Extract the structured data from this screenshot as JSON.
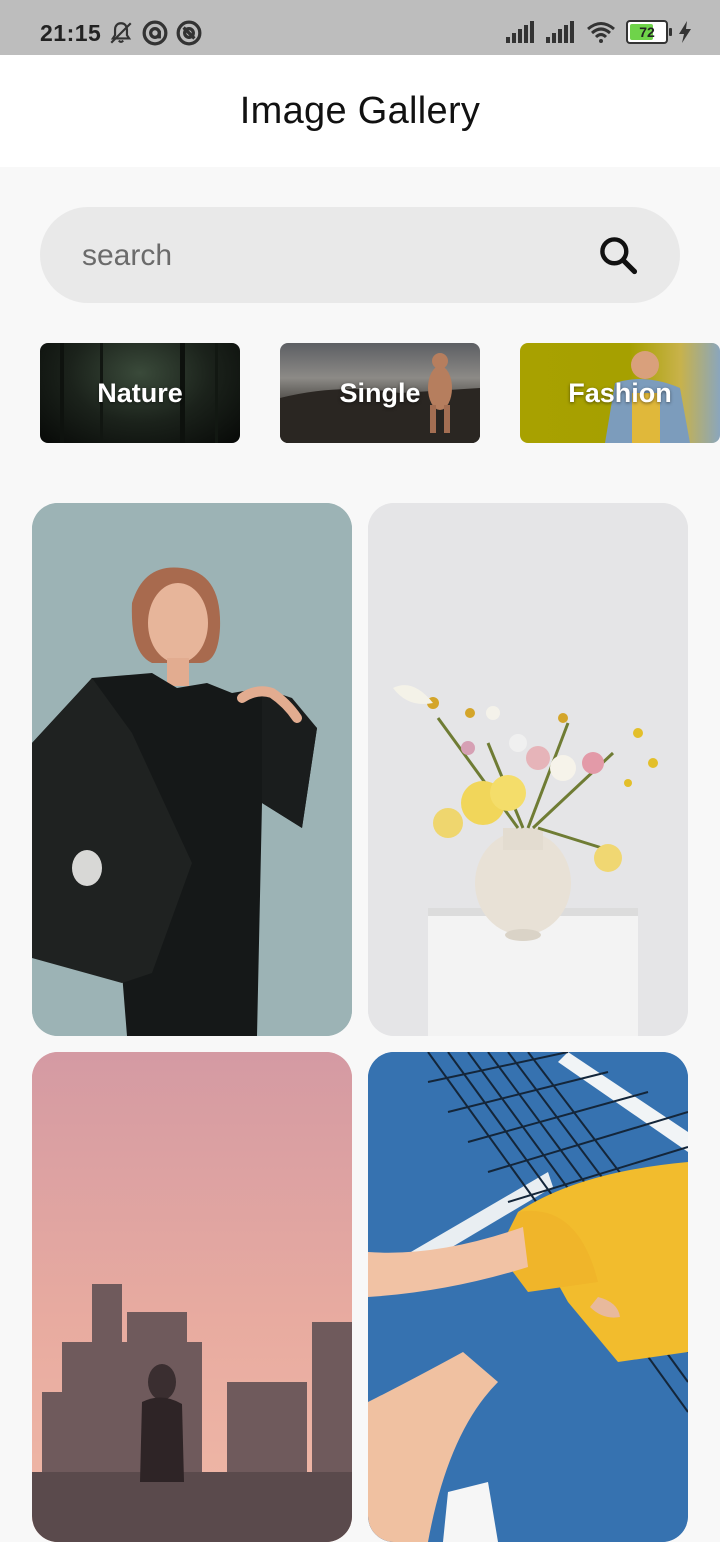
{
  "status_bar": {
    "time": "21:15",
    "battery_level": "72",
    "icons": [
      "bell-muted-icon",
      "circle-a-icon",
      "circle-a-icon",
      "signal-icon",
      "signal-icon",
      "wifi-icon",
      "battery-icon",
      "charging-icon"
    ]
  },
  "app_bar": {
    "title": "Image Gallery"
  },
  "search": {
    "placeholder": "search",
    "value": "",
    "icon": "search-icon"
  },
  "categories": [
    {
      "label": "Nature"
    },
    {
      "label": "Single"
    },
    {
      "label": "Fashion"
    }
  ],
  "gallery": [
    {
      "subject": "woman in black suit"
    },
    {
      "subject": "flowers in vase"
    },
    {
      "subject": "city silhouette at sunset"
    },
    {
      "subject": "person on tennis court"
    }
  ],
  "colors": {
    "status_bar_bg": "#bdbdbd",
    "app_bar_bg": "#ffffff",
    "page_bg": "#f8f8f8",
    "search_bg": "#e9e9e9",
    "battery_green": "#6fd34a"
  }
}
